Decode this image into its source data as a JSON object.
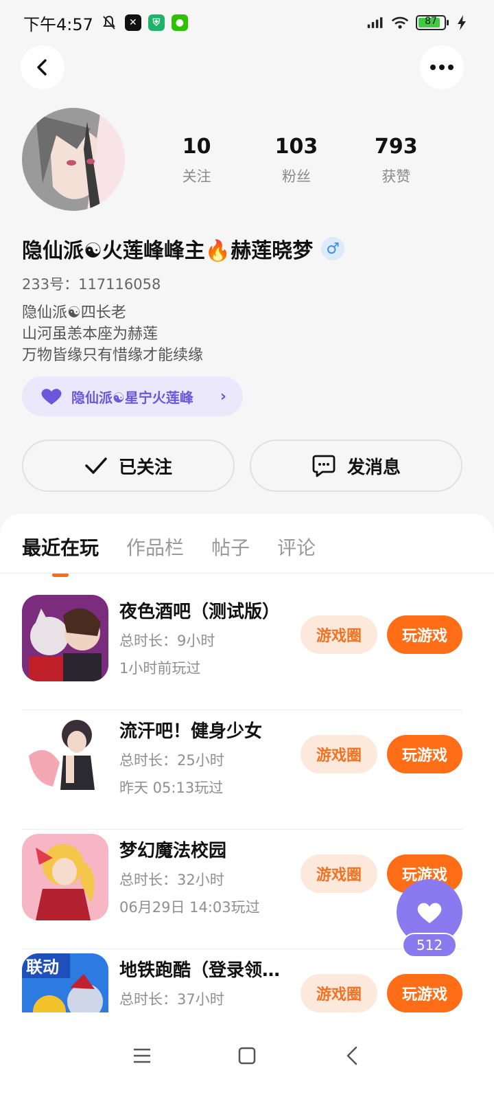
{
  "status_bar": {
    "time": "下午4:57",
    "battery": "87"
  },
  "profile": {
    "stats": [
      {
        "value": "10",
        "label": "关注"
      },
      {
        "value": "103",
        "label": "粉丝"
      },
      {
        "value": "793",
        "label": "获赞"
      }
    ],
    "nickname": "隐仙派☯火莲峰峰主🔥赫莲晓梦",
    "gender": "♂",
    "uid": "233号：117116058",
    "bio": [
      "隐仙派☯四长老",
      "山河虽恙本座为赫莲",
      "万物皆缘只有惜缘才能续缘"
    ],
    "group_tag": "隐仙派☯星宁火莲峰"
  },
  "actions": {
    "follow_label": "已关注",
    "message_label": "发消息"
  },
  "tabs": [
    "最近在玩",
    "作品栏",
    "帖子",
    "评论"
  ],
  "games": [
    {
      "title": "夜色酒吧（测试版）",
      "duration": "总时长：9小时",
      "last_played": "1小时前玩过",
      "circle_label": "游戏圈",
      "play_label": "玩游戏"
    },
    {
      "title": "流汗吧！健身少女",
      "duration": "总时长：25小时",
      "last_played": "昨天 05:13玩过",
      "circle_label": "游戏圈",
      "play_label": "玩游戏"
    },
    {
      "title": "梦幻魔法校园",
      "duration": "总时长：32小时",
      "last_played": "06月29日 14:03玩过",
      "circle_label": "游戏圈",
      "play_label": "玩游戏"
    },
    {
      "title": "地铁跑酷（登录领…",
      "duration": "总时长：37小时",
      "last_played": "",
      "circle_label": "游戏圈",
      "play_label": "玩游戏"
    }
  ],
  "like_fab": {
    "count": "512"
  },
  "colors": {
    "accent": "#ff6e16",
    "purple": "#8b79ef",
    "tag_bg": "#ebe8fb"
  }
}
